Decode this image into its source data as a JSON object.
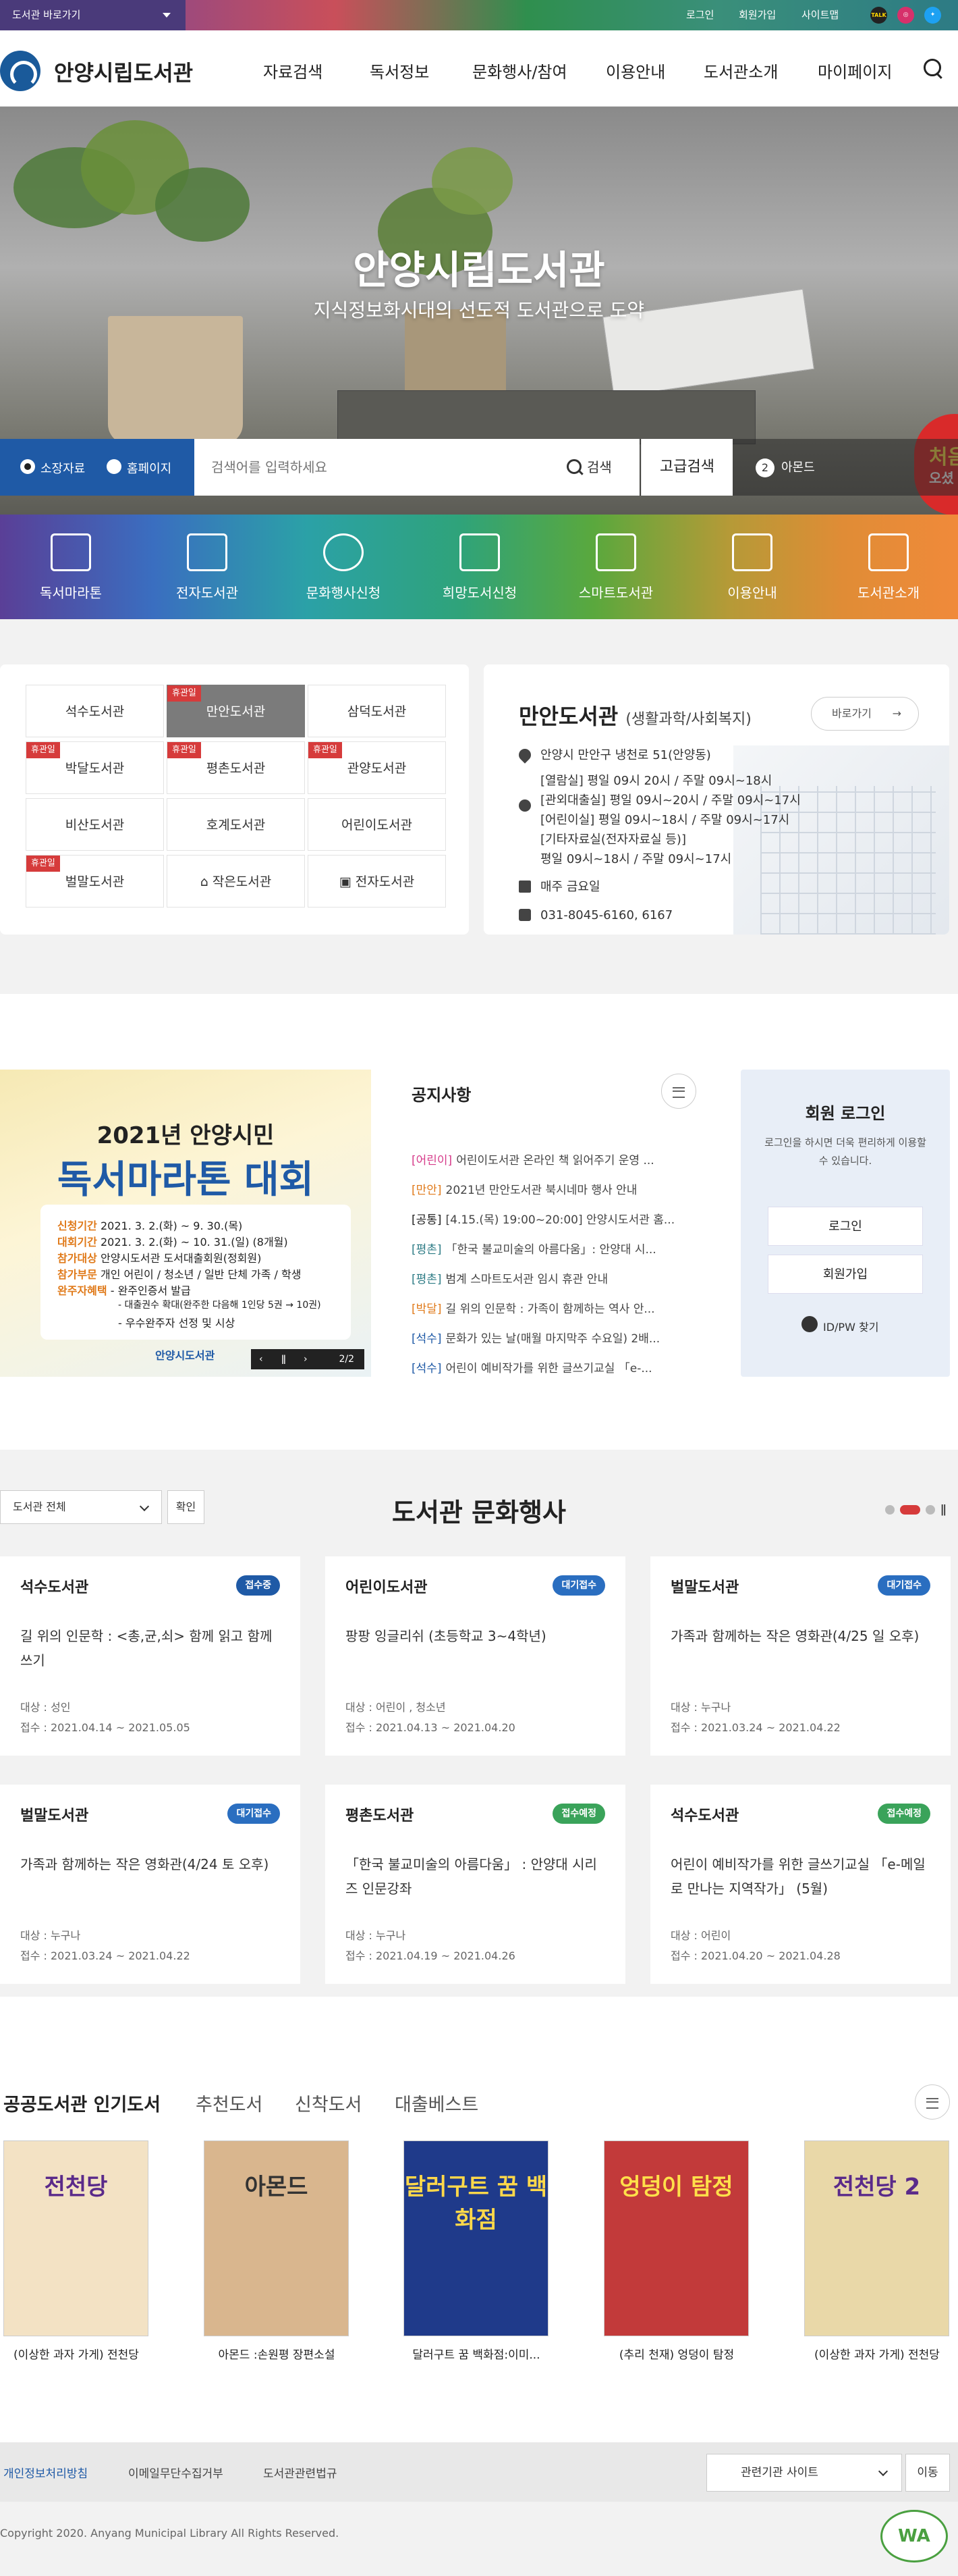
{
  "topbar": {
    "quick_select": "도서관 바로가기",
    "login": "로그인",
    "join": "회원가입",
    "sitemap": "사이트맵",
    "sns": [
      "TALK",
      "insta",
      "twitter"
    ]
  },
  "header": {
    "logo_text": "안양시립도서관",
    "menu": [
      "자료검색",
      "독서정보",
      "문화행사/참여",
      "이용안내",
      "도서관소개",
      "마이페이지"
    ]
  },
  "hero": {
    "title": "안양시립도서관",
    "subtitle": "지식정보화시대의 선도적 도서관으로 도약",
    "promo_main": "처음",
    "promo_sub": "오셨"
  },
  "search": {
    "radio_1": "소장자료",
    "radio_2": "홈페이지",
    "placeholder": "검색어를 입력하세요",
    "button": "검색",
    "advanced": "고급검색",
    "rank_num": "2",
    "rank_word": "아몬드"
  },
  "quick_menu": [
    "독서마라톤",
    "전자도서관",
    "문화행사신청",
    "희망도서신청",
    "스마트도서관",
    "이용안내",
    "도서관소개"
  ],
  "libraries": [
    {
      "name": "석수도서관",
      "tag": ""
    },
    {
      "name": "만안도서관",
      "tag": "휴관일"
    },
    {
      "name": "삼덕도서관",
      "tag": ""
    },
    {
      "name": "박달도서관",
      "tag": "휴관일"
    },
    {
      "name": "평촌도서관",
      "tag": "휴관일"
    },
    {
      "name": "관양도서관",
      "tag": "휴관일"
    },
    {
      "name": "비산도서관",
      "tag": ""
    },
    {
      "name": "호계도서관",
      "tag": ""
    },
    {
      "name": "어린이도서관",
      "tag": ""
    },
    {
      "name": "벌말도서관",
      "tag": "휴관일"
    },
    {
      "name": "작은도서관",
      "tag": ""
    },
    {
      "name": "전자도서관",
      "tag": ""
    }
  ],
  "library_info": {
    "name": "만안도서관",
    "type": "(생활과학/사회복지)",
    "go": "바로가기",
    "address": "안양시 만안구 냉천로 51(안양동)",
    "hours": [
      "[열람실] 평일 09시 20시 / 주말 09시~18시",
      "[관외대출실] 평일 09시~20시 / 주말 09시~17시",
      "[어린이실] 평일 09시~18시 / 주말 09시~17시",
      "[기타자료실(전자자료실 등)]",
      "평일 09시~18시 / 주말 09시~17시"
    ],
    "closed": "매주 금요일",
    "tel": "031-8045-6160, 6167"
  },
  "banner": {
    "top": "2021년 안양시민",
    "big": "독서마라톤 대회",
    "lines": [
      {
        "k": "신청기간",
        "v": "2021. 3. 2.(화) ~ 9. 30.(목)"
      },
      {
        "k": "대회기간",
        "v": "2021. 3. 2.(화) ~ 10. 31.(일) (8개월)"
      },
      {
        "k": "참가대상",
        "v": "안양시도서관 도서대출회원(정회원)"
      },
      {
        "k": "참가부문",
        "v": "개인 어린이 / 청소년 / 일반  단체 가족 / 학생"
      },
      {
        "k": "완주자혜택",
        "v": "- 완주인증서 발급"
      },
      {
        "k": "",
        "v": "- 대출권수 확대(완주한 다음해 1인당 5권 → 10권)"
      },
      {
        "k": "",
        "v": "- 우수완주자 선정 및 시상"
      }
    ],
    "logo": "안양시도서관",
    "counter": "2/2"
  },
  "notice": {
    "title": "공지사항",
    "items": [
      {
        "cat": "[어린이]",
        "color": "#d63b8a",
        "text": "어린이도서관 온라인 책 읽어주기 운영 ..."
      },
      {
        "cat": "[만안]",
        "color": "#e07a1a",
        "text": "2021년 만안도서관 북시네마 행사 안내"
      },
      {
        "cat": "[공통]",
        "color": "#222222",
        "text": "[4.15.(목) 19:00~20:00] 안양시도서관 홈..."
      },
      {
        "cat": "[평촌]",
        "color": "#2d7b85",
        "text": "「한국 불교미술의 아름다움」: 안양대 시..."
      },
      {
        "cat": "[평촌]",
        "color": "#2d7b85",
        "text": "범계 스마트도서관 임시 휴관 안내"
      },
      {
        "cat": "[박달]",
        "color": "#e07a1a",
        "text": "길 위의 인문학 : 가족이 함께하는 역사 안..."
      },
      {
        "cat": "[석수]",
        "color": "#1f5aa6",
        "text": "문화가 있는 날(매월 마지막주 수요일) 2배..."
      },
      {
        "cat": "[석수]",
        "color": "#1f5aa6",
        "text": "어린이 예비작가를 위한 글쓰기교실 「e-..."
      }
    ]
  },
  "member": {
    "title": "회원 로그인",
    "desc": "로그인을 하시면 더욱 편리하게 이용할 수 있습니다.",
    "login": "로그인",
    "join": "회원가입",
    "idpw": "ID/PW 찾기"
  },
  "events": {
    "select": "도서관 전체",
    "confirm": "확인",
    "title": "도서관 문화행사",
    "cards": [
      {
        "lib": "석수도서관",
        "badge": "접수중",
        "color": "#1f5aa6",
        "title": "길 위의 인문학 : <총,균,쇠> 함께 읽고 함께 쓰기",
        "target": "대상 : 성인",
        "period": "접수 : 2021.04.14 ~ 2021.05.05"
      },
      {
        "lib": "어린이도서관",
        "badge": "대기접수",
        "color": "#2a6ec0",
        "title": "팡팡 잉글리쉬 (초등학교 3~4학년)",
        "target": "대상 : 어린이 , 청소년",
        "period": "접수 : 2021.04.13 ~ 2021.04.20"
      },
      {
        "lib": "벌말도서관",
        "badge": "대기접수",
        "color": "#2a6ec0",
        "title": "가족과 함께하는 작은 영화관(4/25 일 오후)",
        "target": "대상 : 누구나",
        "period": "접수 : 2021.03.24 ~ 2021.04.22"
      },
      {
        "lib": "벌말도서관",
        "badge": "대기접수",
        "color": "#2a6ec0",
        "title": "가족과 함께하는 작은 영화관(4/24 토 오후)",
        "target": "대상 : 누구나",
        "period": "접수 : 2021.03.24 ~ 2021.04.22"
      },
      {
        "lib": "평촌도서관",
        "badge": "접수예정",
        "color": "#3aa35a",
        "title": "「한국 불교미술의 아름다움」 : 안양대 시리즈 인문강좌",
        "target": "대상 : 누구나",
        "period": "접수 : 2021.04.19 ~ 2021.04.26"
      },
      {
        "lib": "석수도서관",
        "badge": "접수예정",
        "color": "#3aa35a",
        "title": "어린이 예비작가를 위한 글쓰기교실 「e-메일로 만나는 지역작가」 (5월)",
        "target": "대상 : 어린이",
        "period": "접수 : 2021.04.20 ~ 2021.04.28"
      }
    ]
  },
  "books": {
    "tabs": [
      "공공도서관 인기도서",
      "추천도서",
      "신착도서",
      "대출베스트"
    ],
    "items": [
      {
        "title": "(이상한 과자 가게) 전천당",
        "cover": "전천당",
        "bg": "#f3e2c4",
        "fg": "#5a2a8a"
      },
      {
        "title": "아몬드 :손원평 장편소설",
        "cover": "아몬드",
        "bg": "#d9b68e",
        "fg": "#333333"
      },
      {
        "title": "달러구트 꿈 백화점:이미...",
        "cover": "달러구트 꿈 백화점",
        "bg": "#1f3a8a",
        "fg": "#ffd84a"
      },
      {
        "title": "(추리 천재) 엉덩이 탐정",
        "cover": "엉덩이 탐정",
        "bg": "#c23a3a",
        "fg": "#ffe04a"
      },
      {
        "title": "(이상한 과자 가게) 전천당",
        "cover": "전천당 2",
        "bg": "#e9d8a8",
        "fg": "#5a2a8a"
      }
    ]
  },
  "footer": {
    "links": [
      "개인정보처리방침",
      "이메일무단수집거부",
      "도서관관련법규"
    ],
    "related": "관련기관 사이트",
    "go": "이동",
    "copyright": "Copyright 2020. Anyang Municipal Library All Rights Reserved.",
    "wa": "WA"
  }
}
